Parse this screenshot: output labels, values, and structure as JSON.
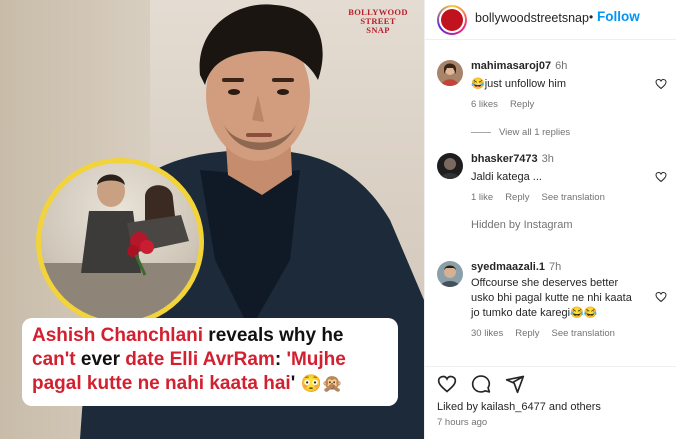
{
  "post": {
    "watermark_lines": [
      "BOLLYWOOD",
      "STREET",
      "SNAP"
    ],
    "headline": {
      "part1_red": "Ashish Chanchlani",
      "part1_black": " reveals why he",
      "part2_red": "can't",
      "part2_black_a": " ever ",
      "part2_red_b": "date Elli AvrRam",
      "part2_black_c": ": ",
      "part2_red_c": "'Mujhe",
      "part3_red": "pagal kutte ne nahi kaata hai",
      "part3_black": "' ",
      "emojis": "😳🙊"
    }
  },
  "header": {
    "username": "bollywoodstreetsnap",
    "separator": "•",
    "follow_label": "Follow"
  },
  "comments": [
    {
      "username": "mahimasaroj07",
      "time": "6h",
      "text": "😂just unfollow him",
      "likes": "6 likes",
      "reply": "Reply"
    },
    {
      "username": "bhasker7473",
      "time": "3h",
      "text": "Jaldi katega ...",
      "likes": "1 like",
      "reply": "Reply",
      "translation": "See translation"
    },
    {
      "username": "syedmaazali.1",
      "time": "7h",
      "text_lines": [
        "Offcourse she deserves better",
        "usko bhi pagal kutte ne nhi kaata",
        "jo tumko date karegi😂😂"
      ],
      "likes": "30 likes",
      "reply": "Reply",
      "translation": "See translation"
    }
  ],
  "view_replies": "View all 1 replies",
  "hidden_note": "Hidden by Instagram",
  "footer": {
    "liked_by_prefix": "Liked by ",
    "liked_by_user": "kailash_6477",
    "liked_by_suffix": " and ",
    "liked_by_others": "others",
    "time_ago": "7 hours ago"
  },
  "icons": {
    "like": "heart-icon",
    "comment": "comment-icon",
    "share": "share-icon",
    "comment_like": "heart-icon"
  },
  "colors": {
    "follow": "#0095f6",
    "headline_red": "#d32030",
    "watermark": "#b81f2a",
    "inset_border": "#f2d33a"
  }
}
